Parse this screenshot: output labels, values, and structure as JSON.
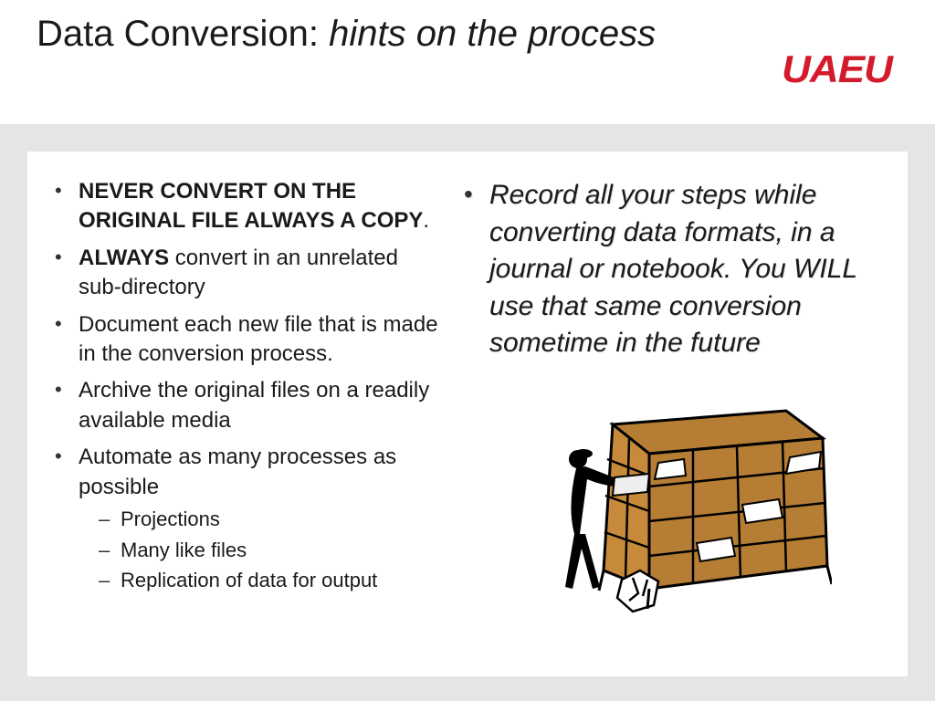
{
  "header": {
    "title_prefix": "Data Conversion: ",
    "title_italic": "hints on the process",
    "logo_text": "UAEU"
  },
  "left_bullets": {
    "b1_bold": "NEVER CONVERT  ON THE ORIGINAL FILE ALWAYS A COPY",
    "b1_tail": ".",
    "b2_bold": "ALWAYS",
    "b2_rest": " convert in an unrelated sub-directory",
    "b3": "Document each new file that is made in the conversion process.",
    "b4": "Archive the original files on a readily available media",
    "b5": "Automate as many processes as possible",
    "sub1": "Projections",
    "sub2": "Many like files",
    "sub3": "Replication of data for output"
  },
  "right_text": "Record all your steps while converting data formats, in a journal or notebook.  You WILL use that same conversion sometime in the future"
}
